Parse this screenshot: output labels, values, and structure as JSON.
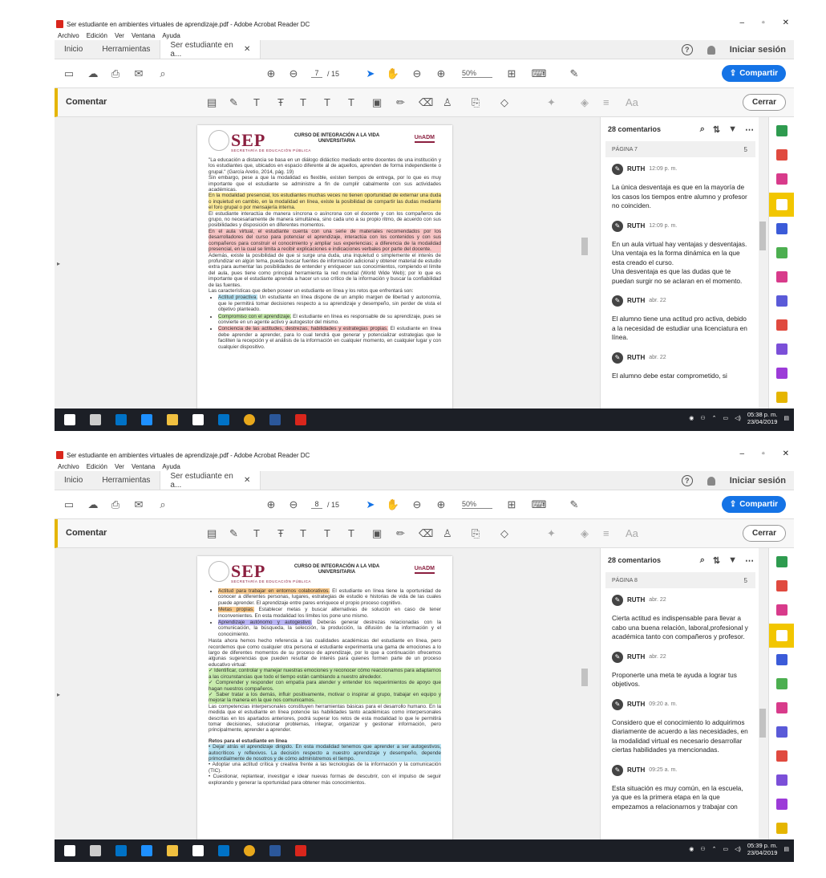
{
  "windows": [
    {
      "title": "Ser estudiante en ambientes virtuales de aprendizaje.pdf - Adobe Acrobat Reader DC",
      "menu": [
        "Archivo",
        "Edición",
        "Ver",
        "Ventana",
        "Ayuda"
      ],
      "tabs": {
        "home": "Inicio",
        "tools": "Herramientas",
        "doc": "Ser estudiante en a...",
        "login": "Iniciar sesión"
      },
      "toolbar": {
        "page_current": "7",
        "page_total": "/ 15",
        "zoom": "50%",
        "share": "Compartir"
      },
      "comment_bar": {
        "label": "Comentar",
        "close": "Cerrar"
      },
      "doc_header": {
        "logo": "SEP",
        "logo_sub": "SECRETARÍA DE EDUCACIÓN PÚBLICA",
        "course": "CURSO DE INTEGRACIÓN A LA VIDA UNIVERSITARIA",
        "brand": "UnADM"
      },
      "doc_text": [
        {
          "t": "\"La educación a distancia se basa en un diálogo didáctico mediado entre docentes de una institución y los estudiantes que, ubicados en espacio diferente al de aquellos, aprenden de forma independiente o grupal.\" (García Aretio, 2014, pág. 19)",
          "h": ""
        },
        {
          "t": "Sin embargo, pese a que la modalidad es flexible, existen tiempos de entrega, por lo que es muy importante que el estudiante se administre a fin de cumplir cabalmente con sus actividades académicas.",
          "h": ""
        },
        {
          "t": "En la modalidad presencial, los estudiantes muchas veces no tienen oportunidad de externar una duda o inquietud en cambio, en la modalidad en línea, existe la posibilidad de compartir las dudas mediante el foro grupal o por mensajería interna.",
          "h": "y"
        },
        {
          "t": "El estudiante interactúa de manera síncrona o asíncrona con el docente y con los compañeros de grupo, no necesariamente de manera simultánea, sino cada uno a su propio ritmo, de acuerdo con sus posibilidades y disposición en diferentes momentos.",
          "h": ""
        },
        {
          "t": "En el aula virtual, el estudiante cuenta con una serie de materiales recomendados por los desarrolladores del curso para potenciar el aprendizaje, interactúa con los contenidos y con sus compañeros para construir el conocimiento y ampliar sus experiencias; a diferencia de la modalidad presencial, en la cual se limita a recibir explicaciones e indicaciones verbales por parte del docente.",
          "h": "r"
        },
        {
          "t": "Además, existe la posibilidad de que si surge una duda, una inquietud o simplemente el interés de profundizar en algún tema, pueda buscar fuentes de información adicional y obtener material de estudio extra para aumentar las posibilidades de entender y enriquecer sus conocimientos, rompiendo el límite del aula, pues tiene como principal herramienta la red mundial (World Wide Web); por lo que es importante que el estudiante aprenda a hacer un uso crítico de la información y buscar la confiabilidad de las fuentes.",
          "h": ""
        },
        {
          "t": "Las características que deben poseer un estudiante en línea y los retos que enfrentará son:",
          "h": ""
        }
      ],
      "doc_bullets": [
        {
          "hl": "Actitud proactiva.",
          "h": "b",
          "t": " Un estudiante en línea dispone de un amplio margen de libertad y autonomía, que le permitirá tomar decisiones respecto a su aprendizaje y desempeño, sin perder de vista el objetivo planteado."
        },
        {
          "hl": "Compromiso con el aprendizaje.",
          "h": "g",
          "t": " El estudiante en línea es responsable de su aprendizaje, pues se convierte en un agente activo y autogestor del mismo."
        },
        {
          "hl": "Conciencia de las actitudes, destrezas, habilidades y estrategias propias.",
          "h": "r",
          "t": " El estudiante en línea debe aprender a aprender, para lo cual tendrá que generar y potencializar estrategias que le faciliten la recepción y el análisis de la información en cualquier momento, en cualquier lugar y con cualquier dispositivo."
        }
      ],
      "panel": {
        "count": "28 comentarios",
        "page": "PÁGINA 7",
        "page_count": "5"
      },
      "comments": [
        {
          "name": "RUTH",
          "time": "12:09 p. m.",
          "text": "La única desventaja es que en la mayoría de los casos los tiempos entre alumno y profesor no coinciden."
        },
        {
          "name": "RUTH",
          "time": "12:09 p. m.",
          "text": "En un aula virtual hay ventajas y desventajas.\nUna ventaja es la forma dinámica en la que esta creado el curso.\nUna desventaja es que las dudas que te puedan surgir no se aclaran en el momento."
        },
        {
          "name": "RUTH",
          "time": "abr. 22",
          "text": "El alumno tiene una actitud pro activa, debido a la necesidad de estudiar una licenciatura en línea."
        },
        {
          "name": "RUTH",
          "time": "abr. 22",
          "text": "El alumno debe estar comprometido, si"
        }
      ],
      "clock": {
        "time": "05:38 p. m.",
        "date": "23/04/2019"
      }
    },
    {
      "title": "Ser estudiante en ambientes virtuales de aprendizaje.pdf - Adobe Acrobat Reader DC",
      "menu": [
        "Archivo",
        "Edición",
        "Ver",
        "Ventana",
        "Ayuda"
      ],
      "tabs": {
        "home": "Inicio",
        "tools": "Herramientas",
        "doc": "Ser estudiante en a...",
        "login": "Iniciar sesión"
      },
      "toolbar": {
        "page_current": "8",
        "page_total": "/ 15",
        "zoom": "50%",
        "share": "Compartir"
      },
      "comment_bar": {
        "label": "Comentar",
        "close": "Cerrar"
      },
      "doc_header": {
        "logo": "SEP",
        "logo_sub": "SECRETARÍA DE EDUCACIÓN PÚBLICA",
        "course": "CURSO DE INTEGRACIÓN A LA VIDA UNIVERSITARIA",
        "brand": "UnADM"
      },
      "doc_text": [],
      "doc_bullets": [
        {
          "hl": "Actitud para trabajar en entornos colaborativos.",
          "h": "o",
          "t": " El estudiante en línea tiene la oportunidad de conocer a diferentes personas, lugares, estrategias de estudio e historias de vida de las cuales puede aprender. El aprendizaje entre pares enriquece el propio proceso cognitivo."
        },
        {
          "hl": "Metas propias.",
          "h": "o",
          "t": " Establecer metas y buscar alternativas de solución en caso de tener inconvenientes. En esta modalidad los límites los pone uno mismo."
        },
        {
          "hl": "Aprendizaje autónomo y autogestivo.",
          "h": "p",
          "t": " Deberás generar destrezas relacionadas con la comunicación, la búsqueda, la selección, la producción, la difusión de la información y el conocimiento."
        }
      ],
      "doc_text2": [
        {
          "t": "Hasta ahora hemos hecho referencia a las cualidades académicas del estudiante en línea, pero recordemos que como cualquier otra persona el estudiante experimenta una gama de emociones a lo largo de diferentes momentos de su proceso de aprendizaje, por lo que a continuación ofrecemos algunas sugerencias que pueden resultar de interés para quienes formen parte de un proceso educativo virtual:",
          "h": ""
        },
        {
          "t": "✓ Identificar, controlar y manejar nuestras emociones y reconocer cómo reaccionamos para adaptarnos a las circunstancias que todo el tiempo están cambiando a nuestro alrededor.",
          "h": "g"
        },
        {
          "t": "✓ Comprender y responder con empatía para atender y entender los requerimientos de apoyo que hagan nuestros compañeros.",
          "h": "g"
        },
        {
          "t": "✓ Saber tratar a los demás, influir positivamente, motivar o inspirar al grupo, trabajar en equipo y mejorar la manera en la que nos comunicamos.",
          "h": "g"
        },
        {
          "t": "Las competencias interpersonales constituyen herramientas básicas para el desarrollo humano. En la medida que el estudiante en línea potencie las habilidades tanto académicas como interpersonales descritas en los apartados anteriores, podrá superar los retos de esta modalidad lo que le permitirá tomar decisiones, solucionar problemas, integrar, organizar y gestionar información, pero principalmente, aprender a aprender.",
          "h": ""
        },
        {
          "t": "Retos para el estudiante en línea",
          "h": "title"
        },
        {
          "t": "• Dejar atrás el aprendizaje dirigido. En esta modalidad tenemos que aprender a ser autogestivos, autocríticos y reflexivos. La decisión respecto a nuestro aprendizaje y desempeño, depende primordialmente de nosotros y de cómo administremos el tiempo.",
          "h": "b"
        },
        {
          "t": "• Adoptar una actitud crítica y creativa frente a las tecnologías de la información y la comunicación (TIC).",
          "h": ""
        },
        {
          "t": "• Cuestionar, replantear, investigar e idear nuevas formas de descubrir, con el impulso de seguir explorando y generar la oportunidad para obtener más conocimientos.",
          "h": ""
        }
      ],
      "panel": {
        "count": "28 comentarios",
        "page": "PÁGINA 8",
        "page_count": "5"
      },
      "comments": [
        {
          "name": "RUTH",
          "time": "abr. 22",
          "text": "Cierta actitud es indispensable para llevar a cabo una buena relación, laboral,profesional y académica tanto con compañeros y profesor."
        },
        {
          "name": "RUTH",
          "time": "abr. 22",
          "text": "Proponerte una meta te ayuda a lograr tus objetivos."
        },
        {
          "name": "RUTH",
          "time": "09:20 a. m.",
          "text": "Considero que el conocimiento lo adquirimos diariamente de acuerdo a las necesidades, en la modalidad virtual es necesario desarrollar ciertas habilidades ya mencionadas."
        },
        {
          "name": "RUTH",
          "time": "09:25 a. m.",
          "text": "Esta situación es muy común, en la escuela, ya que es la primera etapa en la que empezamos a relacionarnos y trabajar con"
        }
      ],
      "clock": {
        "time": "05:39 p. m.",
        "date": "23/04/2019"
      }
    }
  ],
  "colors": {
    "accent": "#1473e6",
    "comment_yellow": "#f2c600",
    "sep_red": "#8b1f3f",
    "taskbar": "#1c1f26"
  }
}
